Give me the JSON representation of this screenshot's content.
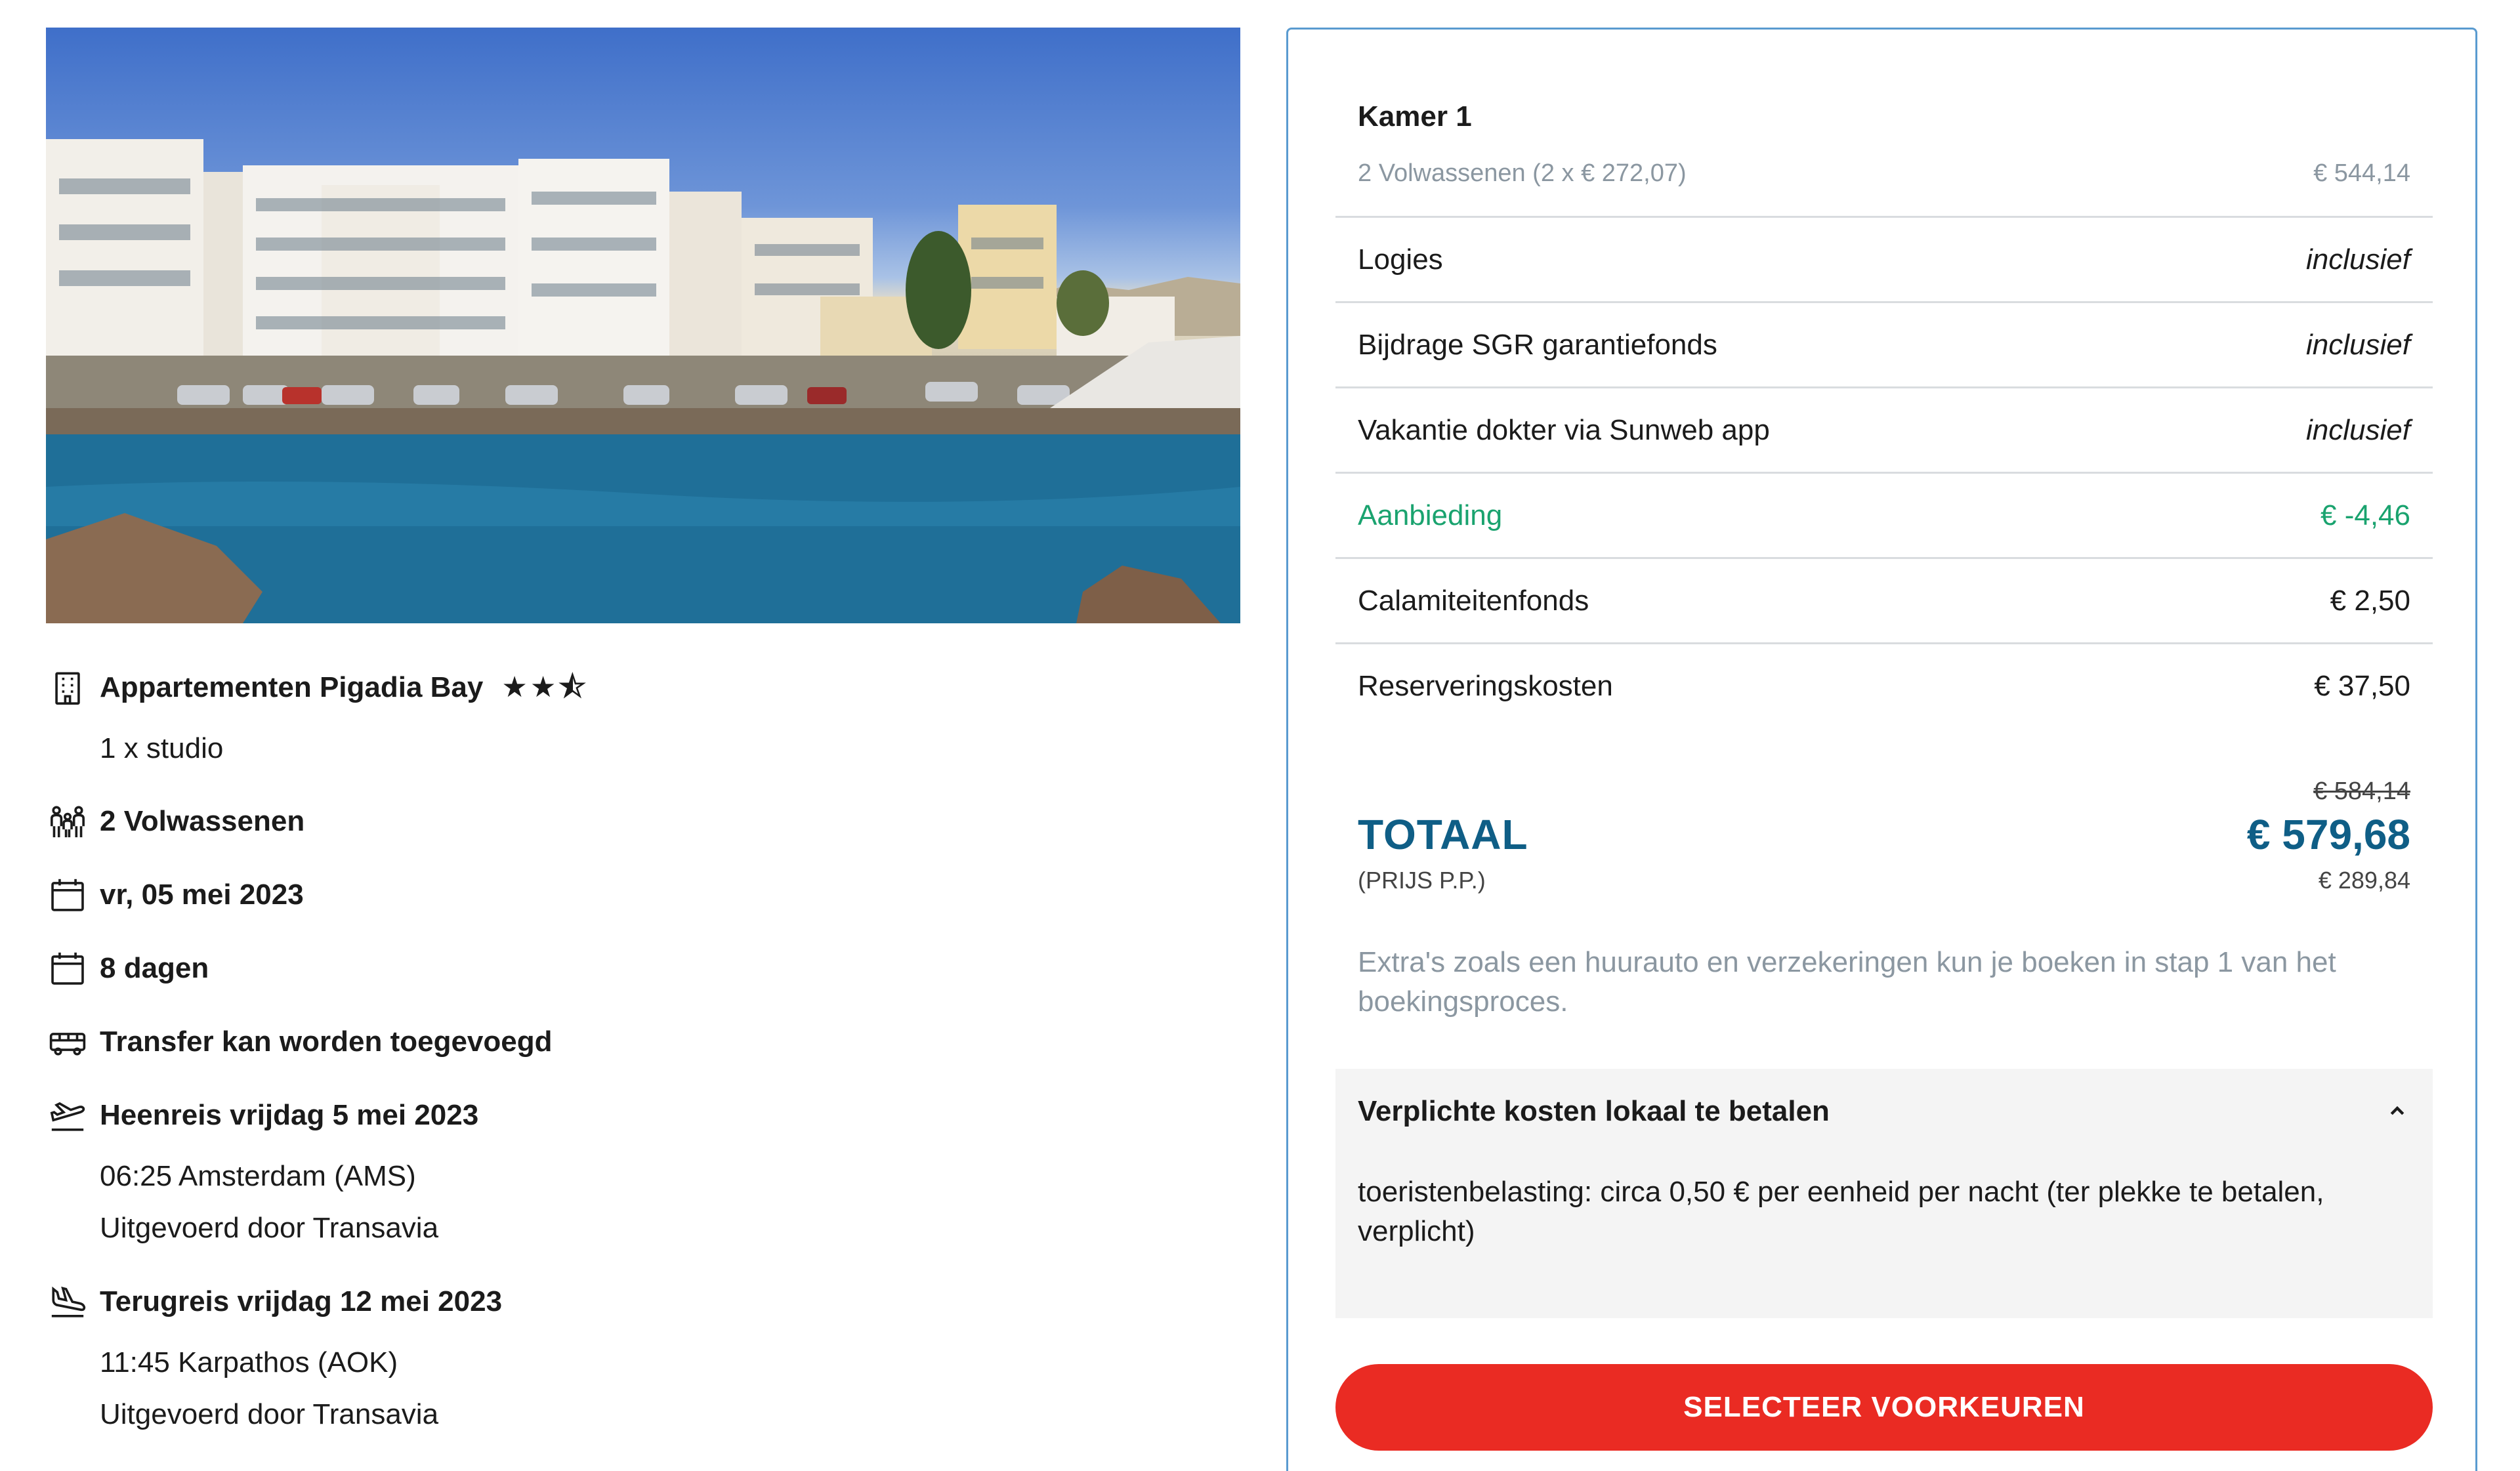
{
  "hotel": {
    "name": "Appartementen Pigadia Bay",
    "rating": "★★⯪",
    "room": "1 x studio"
  },
  "trip": {
    "travellers": "2 Volwassenen",
    "date": "vr, 05 mei 2023",
    "duration": "8 dagen",
    "transfer": "Transfer kan worden toegevoegd"
  },
  "outbound": {
    "title": "Heenreis vrijdag 5 mei 2023",
    "time_airport": "06:25 Amsterdam (AMS)",
    "operator": "Uitgevoerd door Transavia"
  },
  "return": {
    "title": "Terugreis vrijdag 12 mei 2023",
    "time_airport": "11:45 Karpathos (AOK)",
    "operator": "Uitgevoerd door Transavia"
  },
  "price": {
    "room_title": "Kamer 1",
    "room_detail": "2 Volwassenen (2 x € 272,07)",
    "room_amount": "€ 544,14",
    "lines": [
      {
        "label": "Logies",
        "value": "inclusief"
      },
      {
        "label": "Bijdrage SGR garantiefonds",
        "value": "inclusief"
      },
      {
        "label": "Vakantie dokter via Sunweb app",
        "value": "inclusief"
      },
      {
        "label": "Aanbieding",
        "value": "€ -4,46"
      },
      {
        "label": "Calamiteitenfonds",
        "value": "€ 2,50"
      },
      {
        "label": "Reserveringskosten",
        "value": "€ 37,50"
      }
    ],
    "old_total": "€ 584,14",
    "total_label": "TOTAAL",
    "total_value": "€ 579,68",
    "pp_label": "(PRIJS P.P.)",
    "pp_value": "€ 289,84",
    "extras_note": "Extra's zoals een huurauto en verzekeringen kun je boeken in stap 1 van het boekingsproces.",
    "local_costs_title": "Verplichte kosten lokaal te betalen",
    "local_costs_text": "toeristenbelasting: circa 0,50 € per eenheid per nacht (ter plekke te betalen, verplicht)",
    "cta": "SELECTEER VOORKEUREN"
  },
  "colors": {
    "accent_blue": "#0f5e86",
    "offer_green": "#1aa36f",
    "cta_red": "#ea2b23",
    "panel_border": "#5a9bd0",
    "muted": "#8b97a1"
  }
}
